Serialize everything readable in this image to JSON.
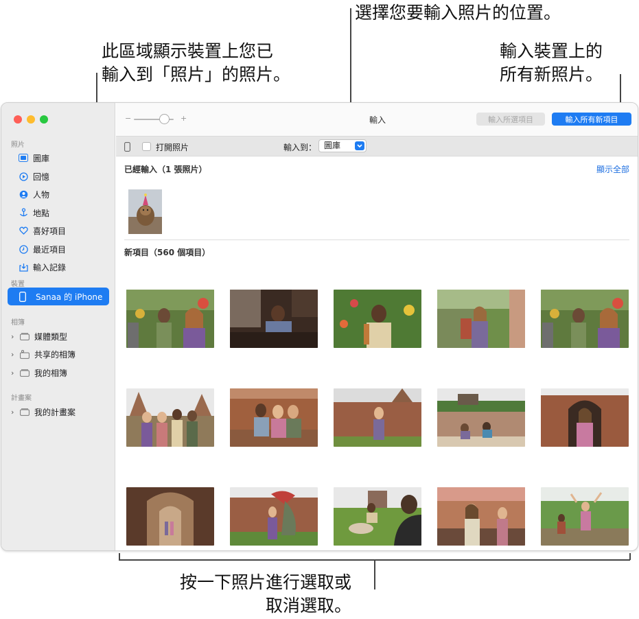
{
  "callouts": {
    "top": "選擇您要輸入照片的位置。",
    "left_line1": "此區域顯示裝置上您已",
    "left_line2": "輸入到「照片」的照片。",
    "right_line1": "輸入裝置上的",
    "right_line2": "所有新照片。",
    "bottom_line1": "按一下照片進行選取或",
    "bottom_line2": "取消選取。"
  },
  "sidebar": {
    "section_photos": "照片",
    "items": [
      {
        "label": "圖庫",
        "icon": "library-icon"
      },
      {
        "label": "回憶",
        "icon": "memories-icon"
      },
      {
        "label": "人物",
        "icon": "people-icon"
      },
      {
        "label": "地點",
        "icon": "places-icon"
      },
      {
        "label": "喜好項目",
        "icon": "heart-icon"
      },
      {
        "label": "最近項目",
        "icon": "clock-icon"
      },
      {
        "label": "輸入記錄",
        "icon": "import-icon"
      }
    ],
    "section_devices": "裝置",
    "device": "Sanaa 的 iPhone",
    "section_albums": "相簿",
    "albums": [
      {
        "label": "媒體類型"
      },
      {
        "label": "共享的相簿"
      },
      {
        "label": "我的相簿"
      }
    ],
    "section_projects": "計畫案",
    "projects": [
      {
        "label": "我的計畫案"
      }
    ]
  },
  "toolbar": {
    "zoom_minus": "−",
    "zoom_plus": "+",
    "title": "輸入",
    "import_selected": "輸入所選項目",
    "import_all_new": "輸入所有新項目"
  },
  "subbar": {
    "open_photos": "打開照片",
    "import_to_label": "輸入到：",
    "import_to_value": "圖庫"
  },
  "content": {
    "already_imported": "已經輸入（1 張照片）",
    "show_all": "顯示全部",
    "new_items": "新項目（560 個項目）"
  },
  "colors": {
    "accent": "#1e7cf2",
    "sidebar_bg": "#ececec"
  }
}
